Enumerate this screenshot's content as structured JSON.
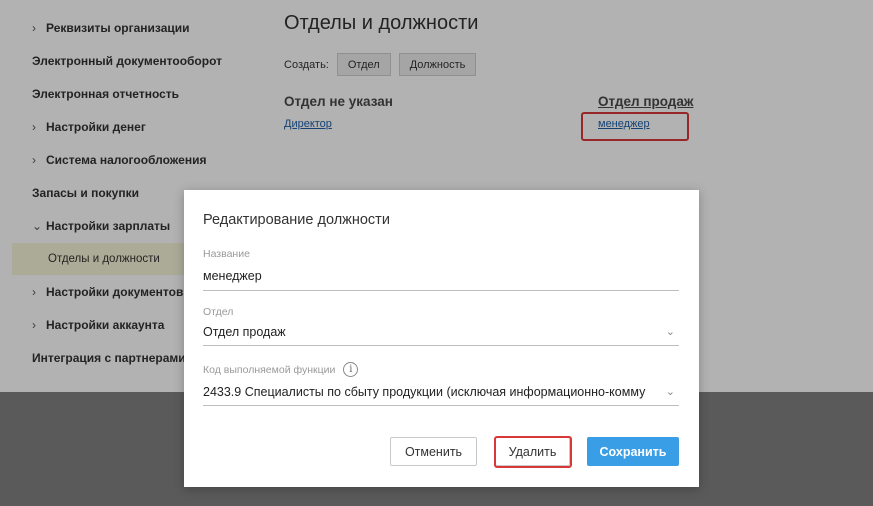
{
  "sidebar": {
    "items": [
      {
        "label": "Реквизиты организации",
        "arrow": "›"
      },
      {
        "label": "Электронный документооборот"
      },
      {
        "label": "Электронная отчетность"
      },
      {
        "label": "Настройки денег",
        "arrow": "›"
      },
      {
        "label": "Система налогообложения",
        "arrow": "›"
      },
      {
        "label": "Запасы и покупки"
      },
      {
        "label": "Настройки зарплаты",
        "arrow": "⌄"
      },
      {
        "label": "Отделы и должности",
        "selected": true
      },
      {
        "label": "Настройки документов",
        "arrow": "›"
      },
      {
        "label": "Настройки аккаунта",
        "arrow": "›"
      },
      {
        "label": "Интеграция с партнерами"
      }
    ]
  },
  "main": {
    "title": "Отделы и должности",
    "create_label": "Создать:",
    "btn_department": "Отдел",
    "btn_position": "Должность",
    "departments": [
      {
        "name": "Отдел не указан",
        "positions": [
          "Директор"
        ]
      },
      {
        "name": "Отдел продаж",
        "positions": [
          "менеджер"
        ]
      }
    ]
  },
  "modal": {
    "title": "Редактирование должности",
    "name_label": "Название",
    "name_value": "менеджер",
    "dept_label": "Отдел",
    "dept_value": "Отдел продаж",
    "func_label": "Код выполняемой функции",
    "func_value": "2433.9 Специалисты по сбыту продукции (исключая информационно-комму",
    "cancel": "Отменить",
    "delete": "Удалить",
    "save": "Сохранить"
  },
  "colors": {
    "accent": "#3a9ee6",
    "highlight": "#d93838",
    "link": "#1e5fa8",
    "selected_bg": "#f7f5d8"
  },
  "icons": {
    "chevron": "chevron-right-icon",
    "select": "chevron-down-icon",
    "info": "info-icon"
  }
}
